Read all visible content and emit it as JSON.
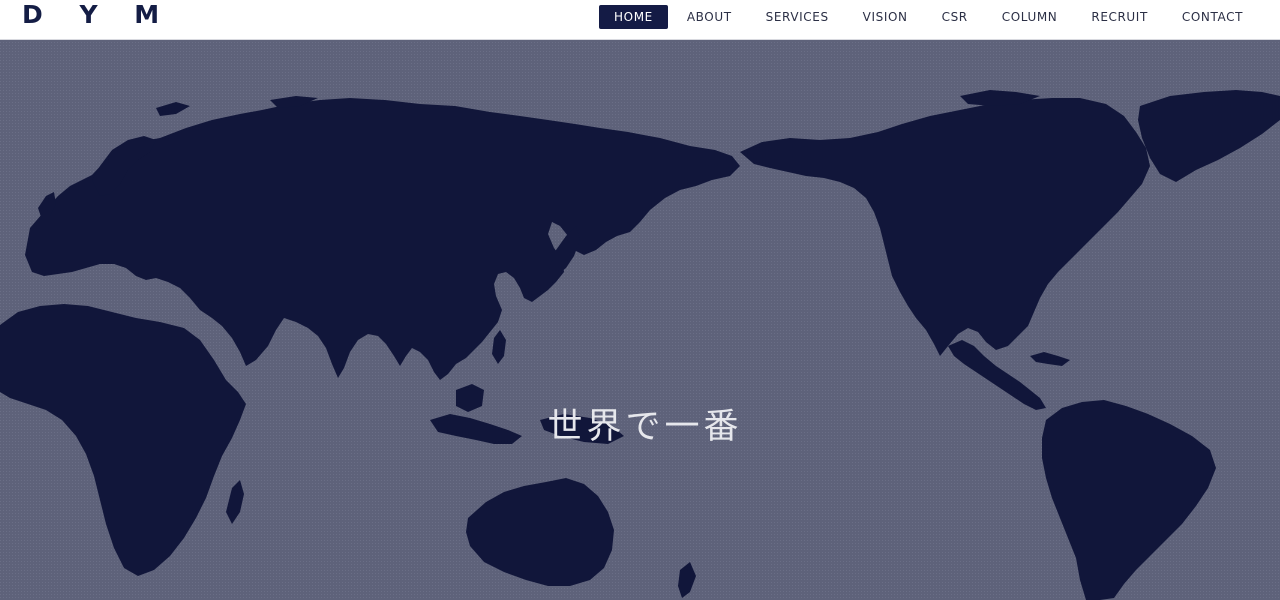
{
  "header": {
    "logo": "D Y M"
  },
  "nav": {
    "items": [
      {
        "label": "HOME",
        "active": true
      },
      {
        "label": "ABOUT"
      },
      {
        "label": "SERVICES"
      },
      {
        "label": "VISION"
      },
      {
        "label": "CSR"
      },
      {
        "label": "COLUMN"
      },
      {
        "label": "RECRUIT"
      },
      {
        "label": "CONTACT"
      }
    ]
  },
  "hero": {
    "tagline": "世界で一番"
  },
  "colors": {
    "brand_navy": "#141b45",
    "ocean": "#5e627a",
    "land": "#11163a"
  }
}
